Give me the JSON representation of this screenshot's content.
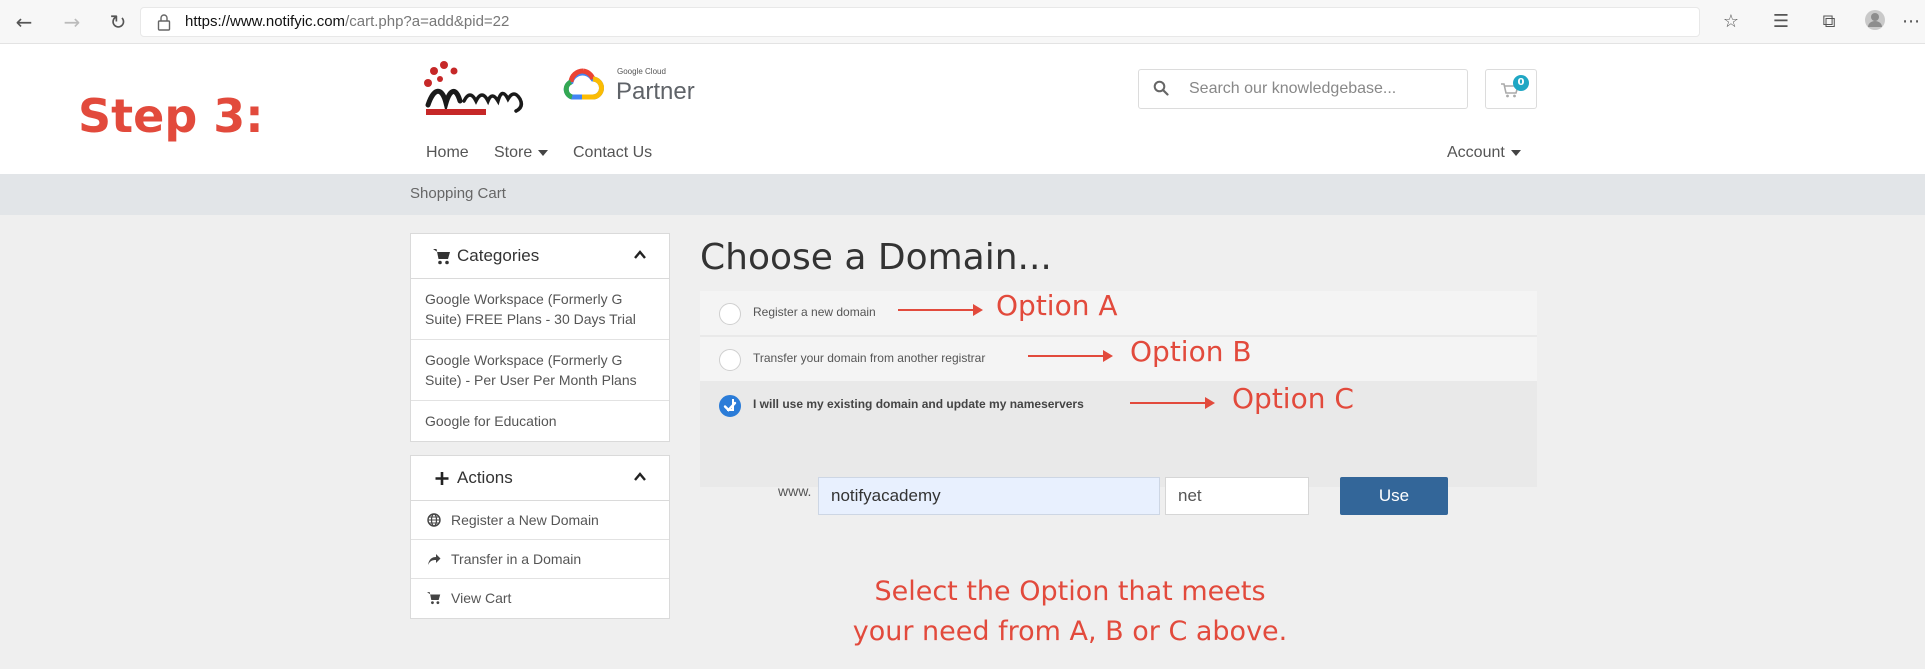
{
  "browser": {
    "url_domain": "https://www.notifyic.com",
    "url_path": "/cart.php?a=add&pid=22"
  },
  "annotations": {
    "step": "Step 3:",
    "option_a": "Option A",
    "option_b": "Option B",
    "option_c": "Option C",
    "instruction": "Select the Option that meets your need from A, B or C above."
  },
  "header": {
    "partner_small": "Google Cloud",
    "partner": "Partner",
    "search_placeholder": "Search our knowledgebase...",
    "cart_count": "0",
    "nav": {
      "home": "Home",
      "store": "Store",
      "contact": "Contact Us",
      "account": "Account"
    }
  },
  "breadcrumb": "Shopping Cart",
  "sidebar": {
    "categories_title": "Categories",
    "categories": [
      "Google Workspace (Formerly G Suite) FREE Plans - 30 Days Trial",
      "Google Workspace (Formerly G Suite) - Per User Per Month Plans",
      "Google for Education"
    ],
    "actions_title": "Actions",
    "actions": [
      "Register a New Domain",
      "Transfer in a Domain",
      "View Cart"
    ]
  },
  "main": {
    "title": "Choose a Domain...",
    "options": [
      {
        "label": "Register a new domain",
        "selected": false
      },
      {
        "label": "Transfer your domain from another registrar",
        "selected": false
      },
      {
        "label": "I will use my existing domain and update my nameservers",
        "selected": true
      }
    ],
    "www_label": "www.",
    "domain_value": "notifyacademy",
    "tld_value": "net",
    "use_button": "Use"
  },
  "colors": {
    "annotation_red": "#e24a3c",
    "button_blue": "#336699",
    "radio_checked": "#2b7cd8",
    "badge_teal": "#1fa7c4"
  }
}
